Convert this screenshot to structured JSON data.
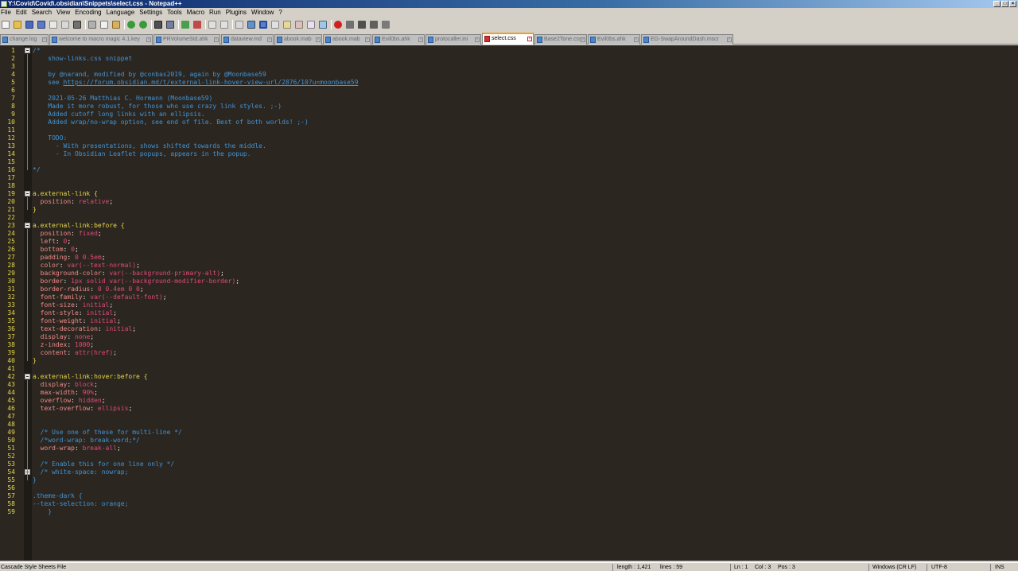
{
  "window": {
    "title": "Y:\\Covid\\Covid\\.obsidian\\Snippets\\select.css - Notepad++"
  },
  "menu": [
    "File",
    "Edit",
    "Search",
    "View",
    "Encoding",
    "Language",
    "Settings",
    "Tools",
    "Macro",
    "Run",
    "Plugins",
    "Window",
    "?"
  ],
  "tabs": [
    {
      "label": "change.log",
      "active": false
    },
    {
      "label": "welcome to macro magic 4.1.key",
      "active": false
    },
    {
      "label": "PRVolumeStd.ahk",
      "active": false
    },
    {
      "label": "dataview.md",
      "active": false
    },
    {
      "label": "abook.mab",
      "active": false
    },
    {
      "label": "abook.mab",
      "active": false
    },
    {
      "label": "Evil0bs.ahk",
      "active": false
    },
    {
      "label": "protocaller.ini",
      "active": false
    },
    {
      "label": "select.css",
      "active": true
    },
    {
      "label": "Base2Tone.css",
      "active": false
    },
    {
      "label": "Evil0bs.ahk",
      "active": false
    },
    {
      "label": "EG-SwapAroundDash.mscr",
      "active": false
    }
  ],
  "code_lines": [
    "/*",
    "    show-links.css snippet",
    "",
    "    by @narand, modified by @conbas2019, again by @Moonbase59",
    "    see https://forum.obsidian.md/t/external-link-hover-view-url/2876/10?u=moonbase59",
    "",
    "    2021-05-26 Matthias C. Hormann (Moonbase59)",
    "    Made it more robust, for those who use crazy link styles. ;-)",
    "    Added cutoff long links with an ellipsis.",
    "    Added wrap/no-wrap option, see end of file. Best of both worlds! ;-)",
    "",
    "    TODO:",
    "      - With presentations, shows shifted towards the middle.",
    "      - In Obsidian Leaflet popups, appears in the popup.",
    "",
    "*/",
    "",
    "",
    "a.external-link {",
    "  position: relative;",
    "}",
    "",
    "a.external-link:before {",
    "  position: fixed;",
    "  left: 0;",
    "  bottom: 0;",
    "  padding: 0 0.5em;",
    "  color: var(--text-normal);",
    "  background-color: var(--background-primary-alt);",
    "  border: 1px solid var(--background-modifier-border);",
    "  border-radius: 0 0.4em 0 0;",
    "  font-family: var(--default-font);",
    "  font-size: initial;",
    "  font-style: initial;",
    "  font-weight: initial;",
    "  text-decoration: initial;",
    "  display: none;",
    "  z-index: 1000;",
    "  content: attr(href);",
    "}",
    "",
    "a.external-link:hover:before {",
    "  display: block;",
    "  max-width: 90%;",
    "  overflow: hidden;",
    "  text-overflow: ellipsis;",
    "",
    "",
    "  /* Use one of these for multi-line */",
    "  /*word-wrap: break-word;*/",
    "  word-wrap: break-all;",
    "",
    "  /* Enable this for one line only */",
    "  /* white-space: nowrap;",
    "}",
    "",
    ".theme-dark {",
    "--text-selection: orange;",
    "    }"
  ],
  "statusbar": {
    "filetype": "Cascade Style Sheets File",
    "length": "length : 1,421",
    "lines": "lines : 59",
    "ln": "Ln : 1",
    "col": "Col : 3",
    "pos": "Pos : 3",
    "eol": "Windows (CR LF)",
    "encoding": "UTF-8",
    "mode": "INS"
  },
  "colors": {
    "editor_bg": "#2b2620",
    "line_number": "#e6d74a",
    "comment": "#3f94d8",
    "selector": "#e6d74a",
    "property": "#f08c8c",
    "value": "#e04a7a",
    "active_tab_accent": "#f0a020"
  }
}
